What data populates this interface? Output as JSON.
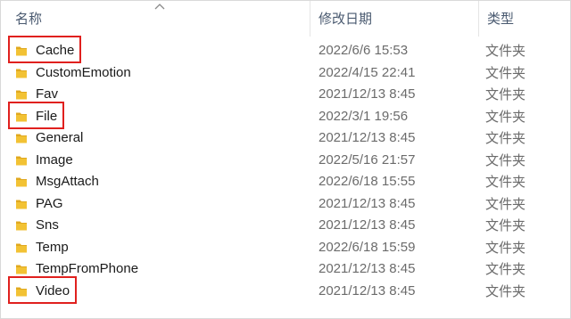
{
  "columns": {
    "name": "名称",
    "date_modified": "修改日期",
    "type": "类型"
  },
  "sort": {
    "column": "name",
    "icon": "sort-up-chevron-icon"
  },
  "folder_icon": {
    "name": "folder-icon",
    "color": "#f2c234",
    "dark": "#e0a81f"
  },
  "highlight_color": "#e0201e",
  "rows": [
    {
      "name": "Cache",
      "date": "2022/6/6 15:53",
      "type": "文件夹",
      "highlighted": true
    },
    {
      "name": "CustomEmotion",
      "date": "2022/4/15 22:41",
      "type": "文件夹",
      "highlighted": false
    },
    {
      "name": "Fav",
      "date": "2021/12/13 8:45",
      "type": "文件夹",
      "highlighted": false
    },
    {
      "name": "File",
      "date": "2022/3/1 19:56",
      "type": "文件夹",
      "highlighted": true
    },
    {
      "name": "General",
      "date": "2021/12/13 8:45",
      "type": "文件夹",
      "highlighted": false
    },
    {
      "name": "Image",
      "date": "2022/5/16 21:57",
      "type": "文件夹",
      "highlighted": false
    },
    {
      "name": "MsgAttach",
      "date": "2022/6/18 15:55",
      "type": "文件夹",
      "highlighted": false
    },
    {
      "name": "PAG",
      "date": "2021/12/13 8:45",
      "type": "文件夹",
      "highlighted": false
    },
    {
      "name": "Sns",
      "date": "2021/12/13 8:45",
      "type": "文件夹",
      "highlighted": false
    },
    {
      "name": "Temp",
      "date": "2022/6/18 15:59",
      "type": "文件夹",
      "highlighted": false
    },
    {
      "name": "TempFromPhone",
      "date": "2021/12/13 8:45",
      "type": "文件夹",
      "highlighted": false
    },
    {
      "name": "Video",
      "date": "2021/12/13 8:45",
      "type": "文件夹",
      "highlighted": true
    }
  ]
}
